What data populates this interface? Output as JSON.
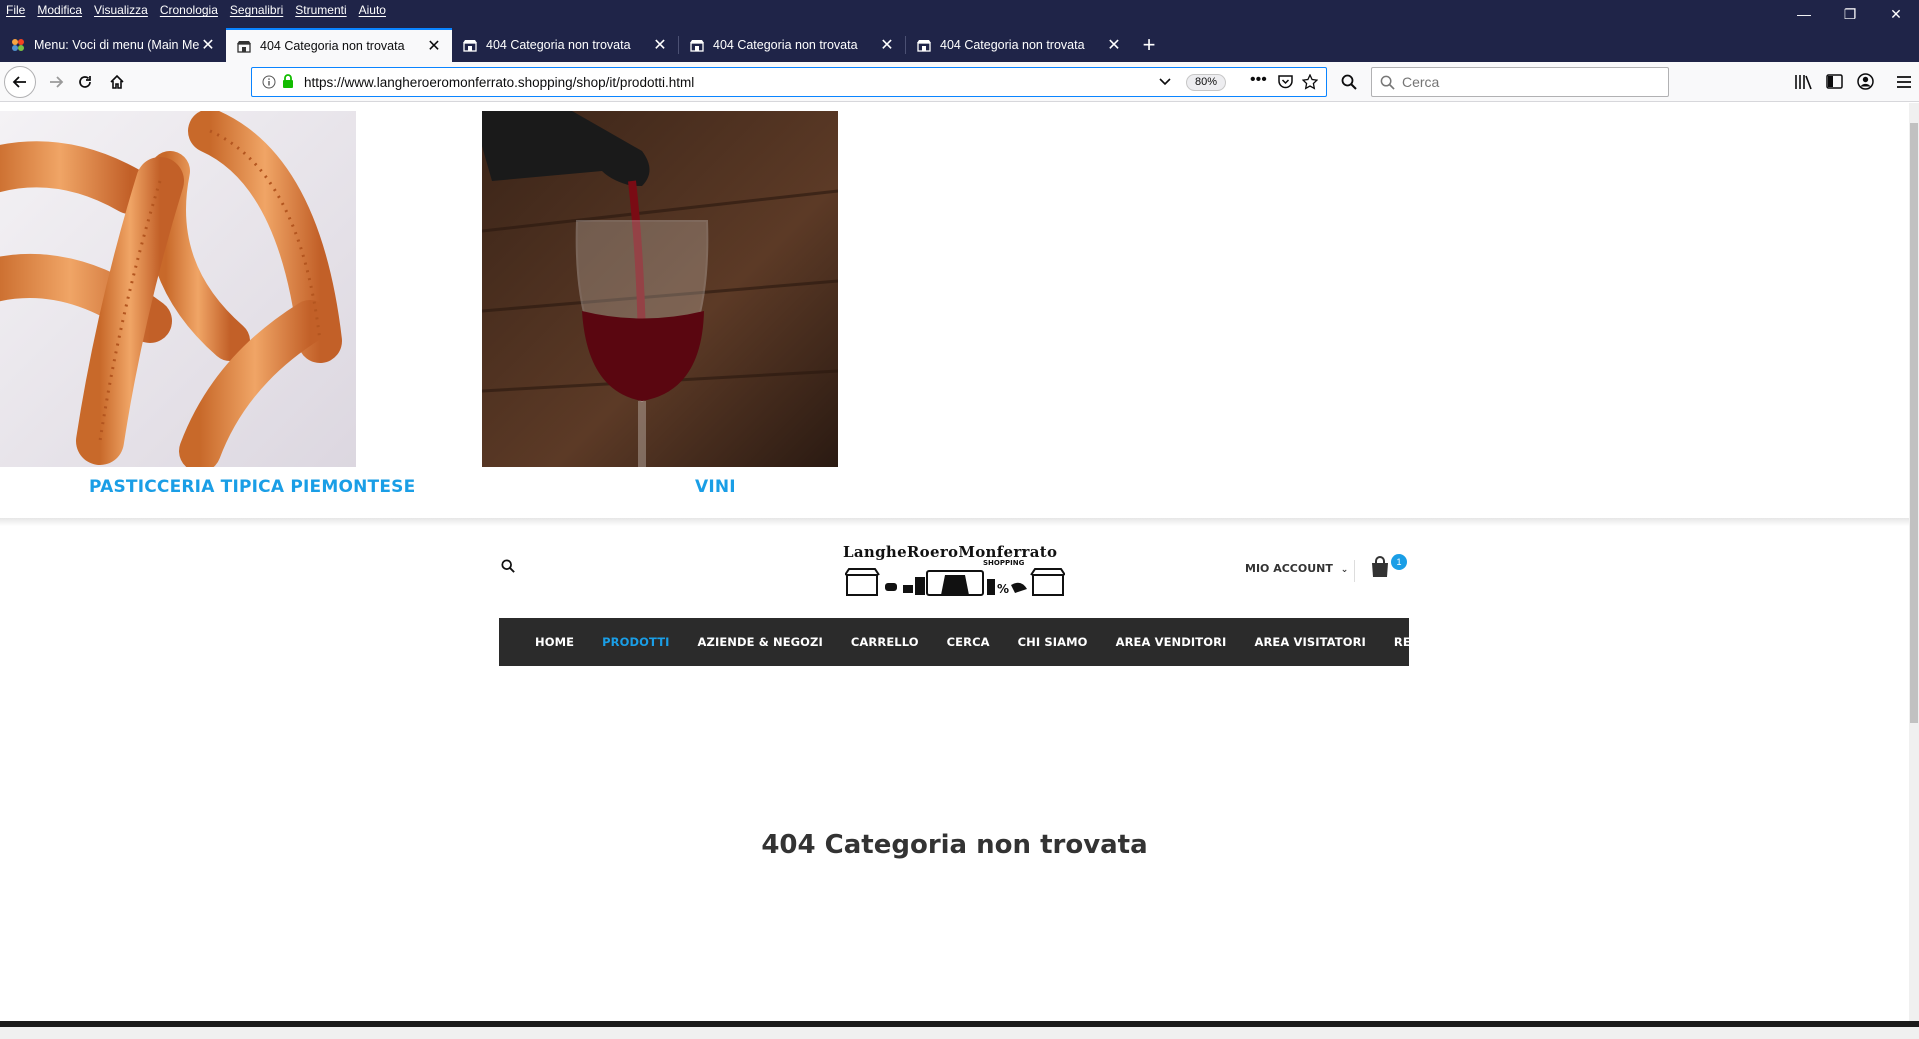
{
  "menubar": [
    "File",
    "Modifica",
    "Visualizza",
    "Cronologia",
    "Segnalibri",
    "Strumenti",
    "Aiuto"
  ],
  "tabs": [
    {
      "title": "Menu: Voci di menu (Main Men",
      "favicon": "joomla-icon"
    },
    {
      "title": "404 Categoria non trovata",
      "favicon": "store-icon"
    },
    {
      "title": "404 Categoria non trovata",
      "favicon": "store-icon"
    },
    {
      "title": "404 Categoria non trovata",
      "favicon": "store-icon"
    },
    {
      "title": "404 Categoria non trovata",
      "favicon": "store-icon"
    }
  ],
  "address": {
    "url": "https://www.langheroeromonferrato.shopping/shop/it/prodotti.html",
    "zoom": "80%"
  },
  "search": {
    "placeholder": "Cerca"
  },
  "categories": [
    {
      "label": "PASTICCERIA TIPICA PIEMONTESE"
    },
    {
      "label": "VINI"
    }
  ],
  "site": {
    "logo_text": "LangheRoeroMonferrato",
    "logo_sub": "SHOPPING",
    "account_label": "MIO ACCOUNT",
    "cart_count": "1",
    "nav": [
      "HOME",
      "PRODOTTI",
      "AZIENDE & NEGOZI",
      "CARRELLO",
      "CERCA",
      "CHI SIAMO",
      "AREA VENDITORI",
      "AREA VISITATORI",
      "REGISTRATI"
    ],
    "active_nav": "PRODOTTI"
  },
  "heading": "404 Categoria non trovata",
  "colors": {
    "accent": "#1a9ee6",
    "chrome": "#1f2448",
    "nav": "#2b2b2b"
  }
}
